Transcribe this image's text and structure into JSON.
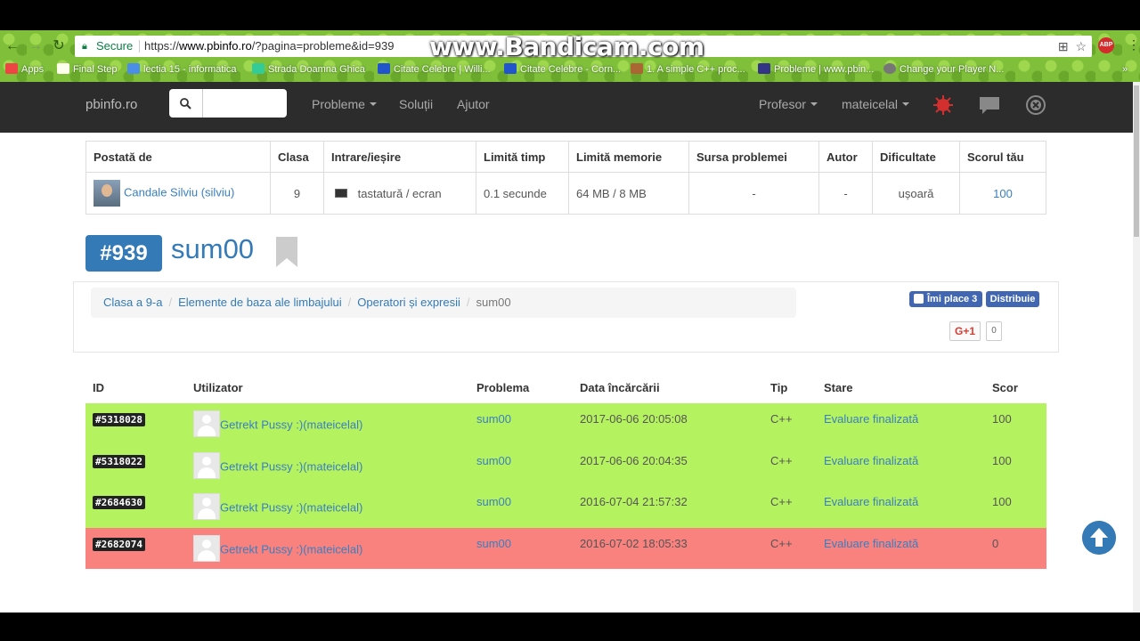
{
  "browser": {
    "secure_label": "Secure",
    "url_prefix": "https://",
    "url_host": "www.pbinfo.ro",
    "url_path": "/?pagina=probleme&id=939",
    "watermark": "www.Bandicam.com",
    "abp_label": "ABP",
    "bookmarks": [
      {
        "label": "Apps"
      },
      {
        "label": "Final Step"
      },
      {
        "label": "lectia 15 - informatica"
      },
      {
        "label": "Strada Doamna Ghica"
      },
      {
        "label": "Citate Celebre | Willi..."
      },
      {
        "label": "Citate Celebre - Corn..."
      },
      {
        "label": "1. A simple C++ proc..."
      },
      {
        "label": "Probleme | www.pbin..."
      },
      {
        "label": "Change your Player N..."
      }
    ]
  },
  "navbar": {
    "brand": "pbinfo.ro",
    "search_icon": "search-icon",
    "search_value": "",
    "links": {
      "probleme": "Probleme",
      "solutii": "Soluții",
      "ajutor": "Ajutor",
      "profesor": "Profesor",
      "user": "mateicelal"
    },
    "icons": [
      "virus-icon",
      "chat-icon",
      "close-circle-icon"
    ]
  },
  "info": {
    "headers": [
      "Postată de",
      "Clasa",
      "Intrare/ieșire",
      "Limită timp",
      "Limită memorie",
      "Sursa problemei",
      "Autor",
      "Dificultate",
      "Scorul tău"
    ],
    "row": {
      "posted_by": "Candale Silviu (silviu)",
      "clasa": "9",
      "io": "tastatură / ecran",
      "time_limit": "0.1 secunde",
      "memory_limit": "64 MB / 8 MB",
      "source": "-",
      "author": "-",
      "difficulty": "ușoară",
      "score": "100"
    }
  },
  "problem": {
    "id": "#939",
    "name": "sum00"
  },
  "breadcrumb": {
    "items": [
      "Clasa a 9-a",
      "Elemente de baza ale limbajului",
      "Operatori și expresii"
    ],
    "active": "sum00"
  },
  "social": {
    "like_label": "Îmi place 3",
    "share_label": "Distribuie",
    "gplus_label": "G+1",
    "gplus_count": "0"
  },
  "submissions": {
    "headers": [
      "ID",
      "Utilizator",
      "Problema",
      "Data încărcării",
      "Tip",
      "Stare",
      "Scor"
    ],
    "rows": [
      {
        "id": "#5318028",
        "user": "Getrekt Pussy :)(mateicelal)",
        "problem": "sum00",
        "date": "2017-06-06 20:05:08",
        "type": "C++",
        "status": "Evaluare finalizată",
        "score": "100",
        "state": "ok"
      },
      {
        "id": "#5318022",
        "user": "Getrekt Pussy :)(mateicelal)",
        "problem": "sum00",
        "date": "2017-06-06 20:04:35",
        "type": "C++",
        "status": "Evaluare finalizată",
        "score": "100",
        "state": "ok"
      },
      {
        "id": "#2684630",
        "user": "Getrekt Pussy :)(mateicelal)",
        "problem": "sum00",
        "date": "2016-07-04 21:57:32",
        "type": "C++",
        "status": "Evaluare finalizată",
        "score": "100",
        "state": "ok"
      },
      {
        "id": "#2682074",
        "user": "Getrekt Pussy :)(mateicelal)",
        "problem": "sum00",
        "date": "2016-07-02 18:05:33",
        "type": "C++",
        "status": "Evaluare finalizată",
        "score": "0",
        "state": "fail"
      }
    ]
  },
  "colors": {
    "ok_row": "#b5f25f",
    "fail_row": "#f9817e",
    "accent": "#337ab7",
    "navbar": "#2c2c2c"
  }
}
